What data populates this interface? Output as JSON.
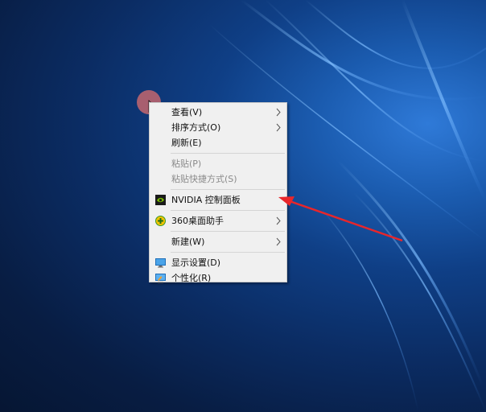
{
  "desktop": {
    "background_color": "#0b2c63"
  },
  "context_menu": {
    "items": [
      {
        "label": "查看(V)",
        "has_submenu": true,
        "enabled": true
      },
      {
        "label": "排序方式(O)",
        "has_submenu": true,
        "enabled": true
      },
      {
        "label": "刷新(E)",
        "has_submenu": false,
        "enabled": true
      },
      {
        "label": "粘贴(P)",
        "has_submenu": false,
        "enabled": false
      },
      {
        "label": "粘贴快捷方式(S)",
        "has_submenu": false,
        "enabled": false
      },
      {
        "label": "NVIDIA 控制面板",
        "icon": "nvidia-icon",
        "has_submenu": false,
        "enabled": true
      },
      {
        "label": "360桌面助手",
        "icon": "360-desktop-icon",
        "has_submenu": true,
        "enabled": true
      },
      {
        "label": "新建(W)",
        "has_submenu": true,
        "enabled": true
      },
      {
        "label": "显示设置(D)",
        "icon": "display-settings-icon",
        "has_submenu": false,
        "enabled": true
      },
      {
        "label": "个性化(R)",
        "icon": "personalize-icon",
        "has_submenu": false,
        "enabled": true
      }
    ]
  },
  "annotation": {
    "arrow_color": "#e8262b",
    "points_to": "NVIDIA 控制面板"
  },
  "colors": {
    "menu_background": "#f0f0f0",
    "disabled_text": "#8a8a8a",
    "nvidia_green": "#76b900",
    "accent_360": "#f3c300"
  }
}
